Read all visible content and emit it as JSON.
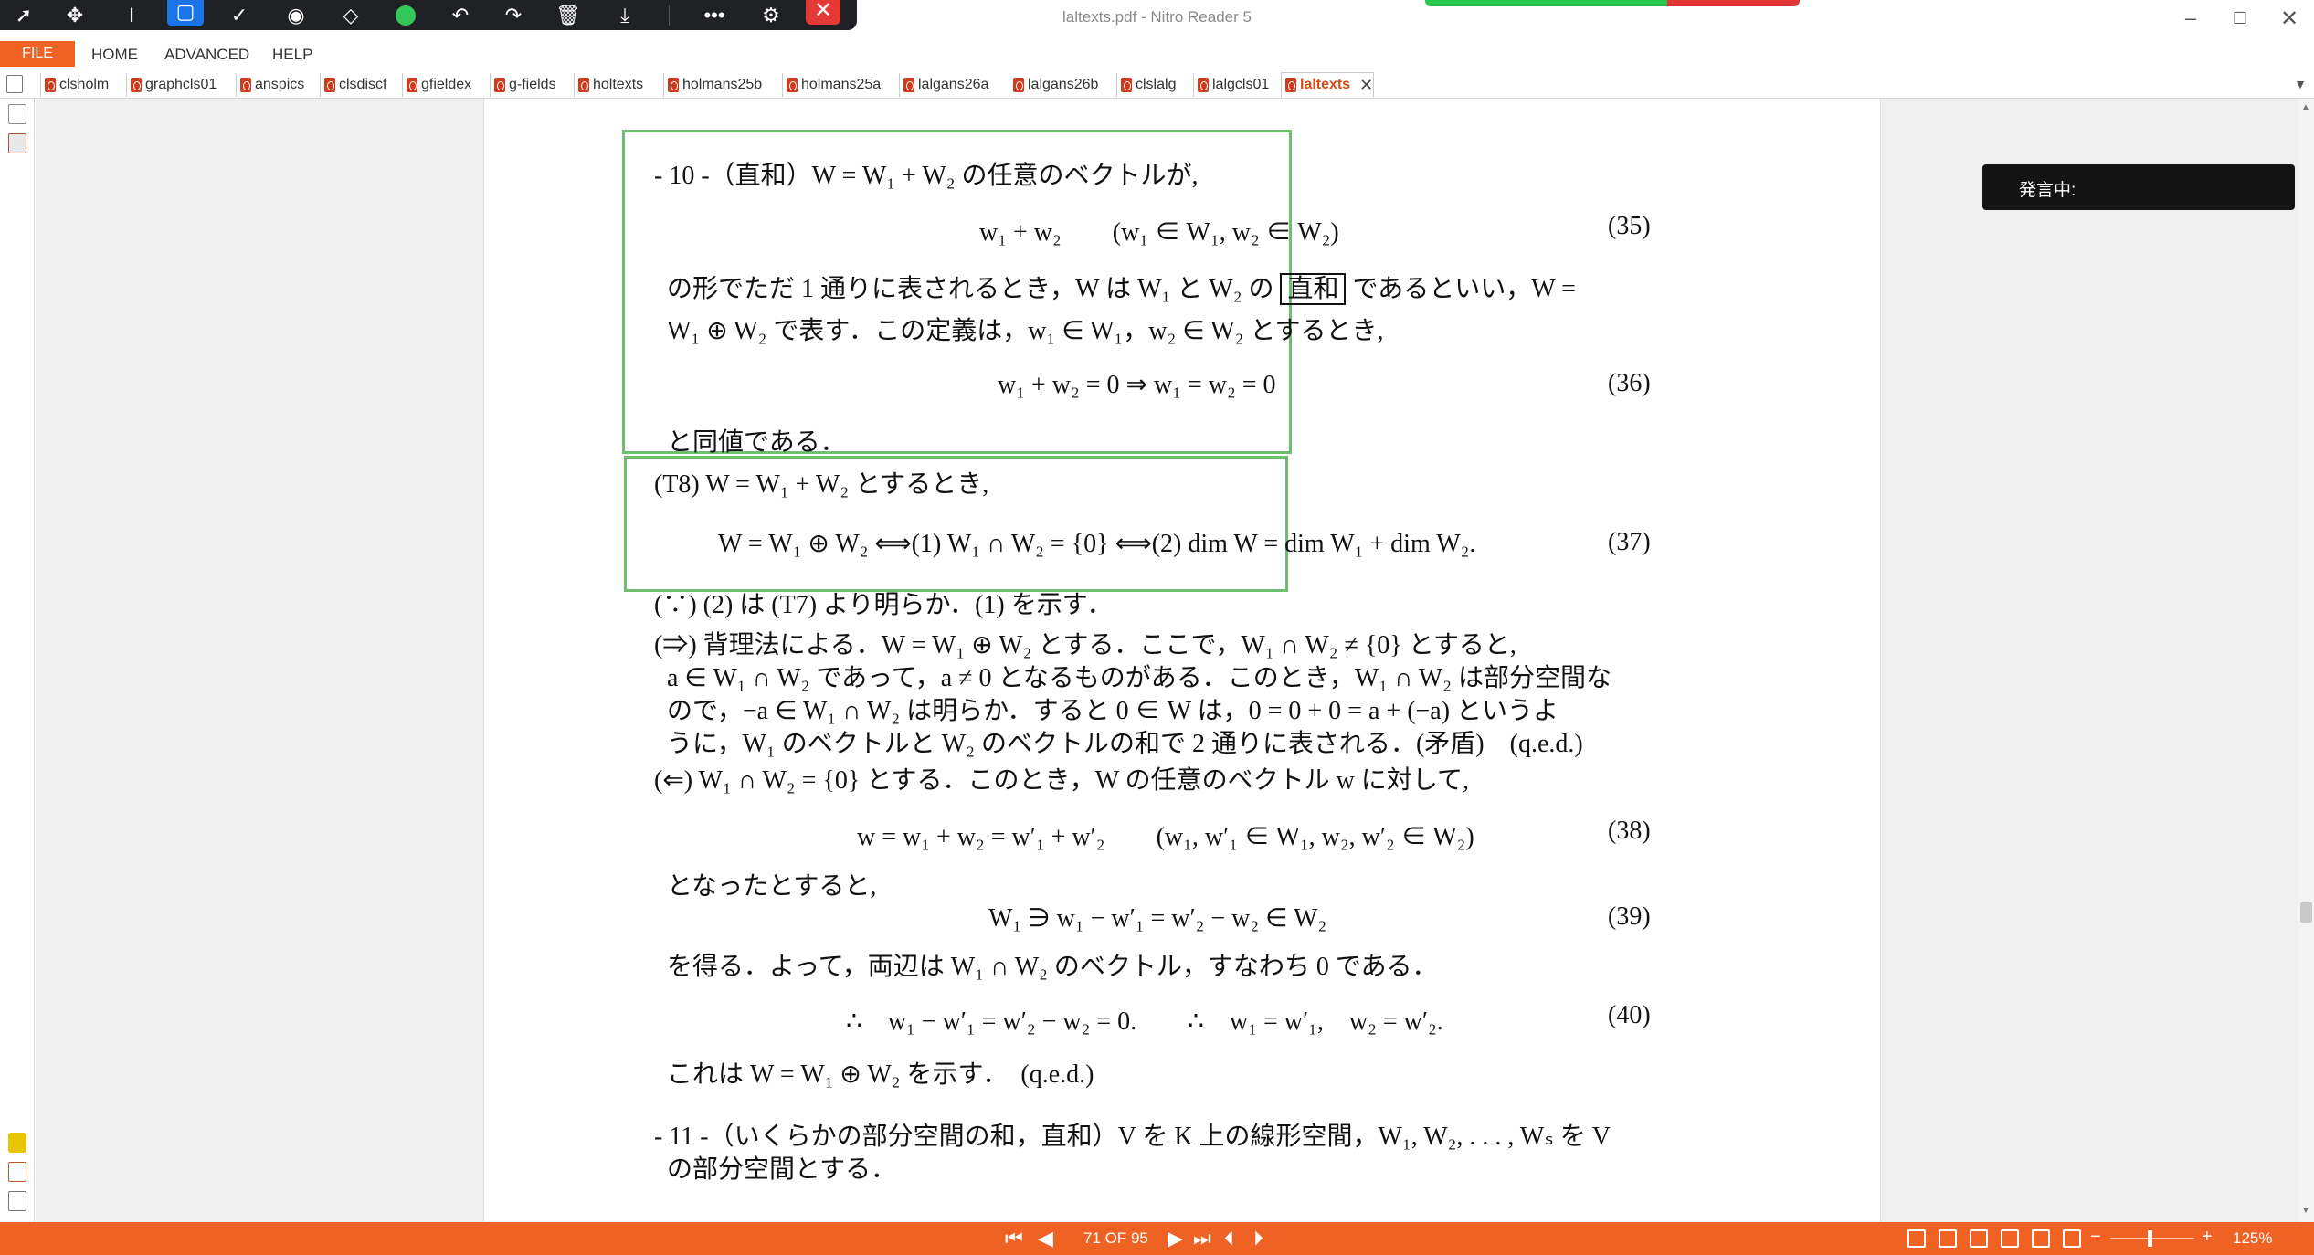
{
  "window": {
    "title": "laltexts.pdf - Nitro Reader 5"
  },
  "toolbar": {
    "icons": [
      "pointer-icon",
      "pan-icon",
      "text-select-icon",
      "rectangle-select-icon",
      "check-icon",
      "record-icon",
      "eraser-icon",
      "record-dot-icon",
      "undo-icon",
      "redo-icon",
      "trash-icon",
      "download-icon",
      "more-icon",
      "user-settings-icon",
      "stop-icon"
    ]
  },
  "menu": {
    "file": "FILE",
    "home": "HOME",
    "advanced": "ADVANCED",
    "help": "HELP"
  },
  "tabs": [
    {
      "label": "clsholm"
    },
    {
      "label": "graphcls01"
    },
    {
      "label": "anspics"
    },
    {
      "label": "clsdiscf"
    },
    {
      "label": "gfieldex"
    },
    {
      "label": "g-fields"
    },
    {
      "label": "holtexts"
    },
    {
      "label": "holmans25b"
    },
    {
      "label": "holmans25a"
    },
    {
      "label": "lalgans26a"
    },
    {
      "label": "lalgans26b"
    },
    {
      "label": "clslalg"
    },
    {
      "label": "lalgcls01"
    },
    {
      "label": "laltexts",
      "active": true
    }
  ],
  "overlay": {
    "speaking": "発言中:"
  },
  "document": {
    "line1": "- 10 -（直和）W = W₁ + W₂ の任意のベクトルが,",
    "eq35": "w₁ + w₂　　(w₁ ∈ W₁, w₂ ∈ W₂)",
    "eq35_no": "(35)",
    "line2a": "の形でただ 1 通りに表されるとき，W は W₁ と W₂ の",
    "line2_boxed": "直和",
    "line2b": "であるといい，W =",
    "line3": "W₁ ⊕ W₂ で表す．この定義は，w₁ ∈ W₁，w₂ ∈ W₂ とするとき,",
    "eq36": "w₁ + w₂ = 0 ⇒ w₁ = w₂ = 0",
    "eq36_no": "(36)",
    "line4": "と同値である．",
    "t8": "(T8) W = W₁ + W₂ とするとき,",
    "eq37": "W = W₁ ⊕ W₂ ⟺(1) W₁ ∩ W₂ = {0} ⟺(2) dim W = dim W₁ + dim W₂.",
    "eq37_no": "(37)",
    "line5": "(∵) (2) は (T7) より明らか．(1) を示す．",
    "line6": "(⇒) 背理法による．W = W₁ ⊕ W₂ とする．ここで，W₁ ∩ W₂ ≠ {0} とすると,",
    "line7": "a ∈ W₁ ∩ W₂ であって，a ≠ 0 となるものがある．このとき，W₁ ∩ W₂ は部分空間な",
    "line8": "ので，−a ∈ W₁ ∩ W₂ は明らか．すると 0 ∈ W は，0 = 0 + 0 = a + (−a) というよ",
    "line9": "うに，W₁ のベクトルと W₂ のベクトルの和で 2 通りに表される．(矛盾)　(q.e.d.)",
    "line10": "(⇐) W₁ ∩ W₂ = {0} とする．このとき，W の任意のベクトル w に対して,",
    "eq38": "w = w₁ + w₂ = w′₁ + w′₂　　(w₁, w′₁ ∈ W₁, w₂, w′₂ ∈ W₂)",
    "eq38_no": "(38)",
    "line11": "となったとすると,",
    "eq39": "W₁ ∋ w₁ − w′₁ = w′₂ − w₂ ∈ W₂",
    "eq39_no": "(39)",
    "line12": "を得る．よって，両辺は W₁ ∩ W₂ のベクトル，すなわち 0 である．",
    "eq40": "∴　w₁ − w′₁ = w′₂ − w₂ = 0.　　∴　w₁ = w′₁,　w₂ = w′₂.",
    "eq40_no": "(40)",
    "line13": "これは W = W₁ ⊕ W₂ を示す．　(q.e.d.)",
    "line14": "- 11 -（いくらかの部分空間の和，直和）V を K 上の線形空間，W₁, W₂, . . . , Wₛ を V",
    "line15": "の部分空間とする．"
  },
  "statusbar": {
    "page_indicator": "71 OF 95",
    "zoom": "125%",
    "zoom_level": 0.45
  }
}
